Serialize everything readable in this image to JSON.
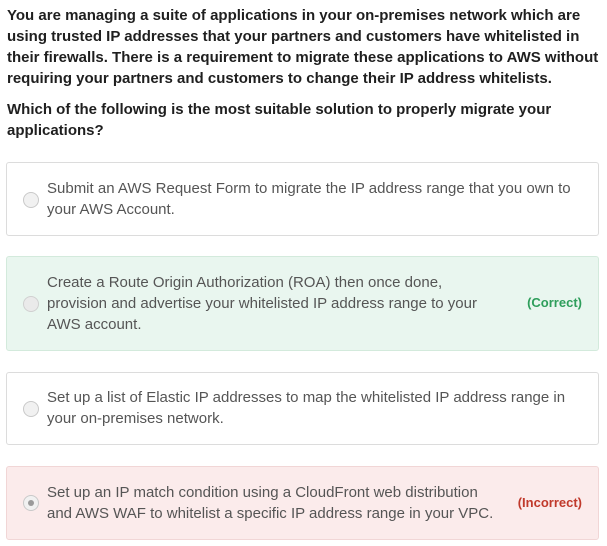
{
  "question": {
    "statement": "You are managing a suite of applications in your on-premises network which are using trusted IP addresses that your partners and customers have whitelisted in their firewalls. There is a requirement to migrate these applications to AWS without requiring your partners and customers to change their IP address whitelists.",
    "prompt": "Which of the following is the most suitable solution to properly migrate your applications?"
  },
  "options": [
    {
      "text": "Submit an AWS Request Form to migrate the IP address range that you own to your AWS Account.",
      "selected": false,
      "status": ""
    },
    {
      "text": "Create a Route Origin Authorization (ROA) then once done, provision and advertise your whitelisted IP address range to your AWS account.",
      "selected": false,
      "status": "(Correct)"
    },
    {
      "text": "Set up a list of Elastic IP addresses to map the whitelisted IP address range in your on-premises network.",
      "selected": false,
      "status": ""
    },
    {
      "text": "Set up an IP match condition using a CloudFront web distribution and AWS WAF to whitelist a specific IP address range in your VPC.",
      "selected": true,
      "status": "(Incorrect)"
    }
  ],
  "colors": {
    "correct_bg": "#e9f6ef",
    "correct_text": "#2e9e5b",
    "incorrect_bg": "#fbebeb",
    "incorrect_text": "#c0392b",
    "border": "#dcdcdc"
  }
}
